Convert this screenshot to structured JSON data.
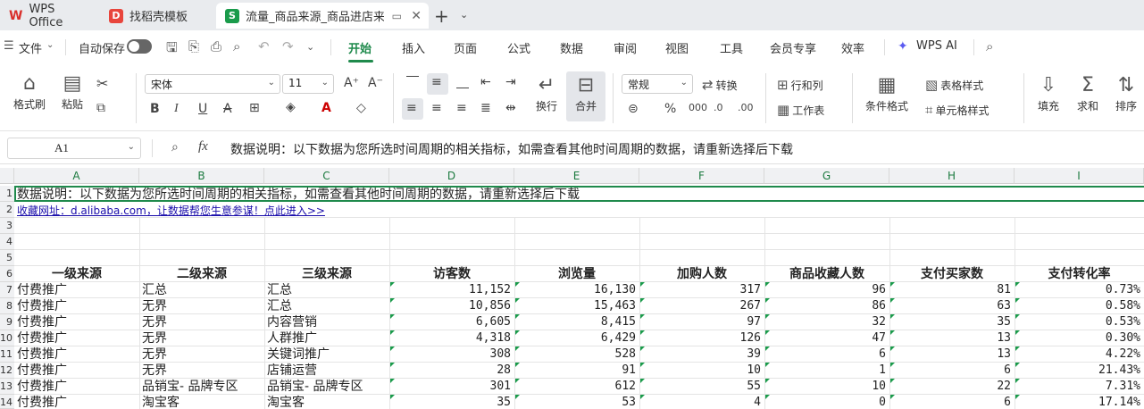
{
  "tabs": [
    {
      "label": "WPS Office",
      "icon": "wps-logo-icon",
      "active": false
    },
    {
      "label": "找稻壳模板",
      "icon": "docer-icon",
      "active": false
    },
    {
      "label": "流量_商品来源_商品进店来源",
      "icon": "spreadsheet-icon",
      "active": true
    }
  ],
  "menu": {
    "file": "文件",
    "autosave": "自动保存",
    "items": [
      "开始",
      "插入",
      "页面",
      "公式",
      "数据",
      "审阅",
      "视图",
      "工具",
      "会员专享",
      "效率"
    ],
    "wps_ai": "WPS AI",
    "active": "开始"
  },
  "ribbon": {
    "format_painter": "格式刷",
    "paste": "粘贴",
    "font_name": "宋体",
    "font_size": "11",
    "wrap": "换行",
    "merge": "合并",
    "number_format": "常规",
    "convert": "转换",
    "row_col": "行和列",
    "worksheet": "工作表",
    "cond_format": "条件格式",
    "table_style": "表格样式",
    "cell_style": "单元格样式",
    "fill": "填充",
    "sum": "求和",
    "sort": "排序",
    "accent": "#1f8a4c"
  },
  "formula_bar": {
    "cell_ref": "A1",
    "fx": "fx",
    "content": "数据说明：以下数据为您所选时间周期的相关指标，如需查看其他时间周期的数据，请重新选择后下载"
  },
  "columns": [
    "A",
    "B",
    "C",
    "D",
    "E",
    "F",
    "G",
    "H",
    "I"
  ],
  "rows": [
    "1",
    "2",
    "3",
    "4",
    "5",
    "6",
    "7",
    "8",
    "9",
    "10",
    "11",
    "12",
    "13",
    "14"
  ],
  "sheet": {
    "a1": "数据说明：以下数据为您所选时间周期的相关指标，如需查看其他时间周期的数据，请重新选择后下载",
    "a2": "收藏网址：d.alibaba.com，让数据帮您生意参谋！点此进入>>",
    "headers": [
      "一级来源",
      "二级来源",
      "三级来源",
      "访客数",
      "浏览量",
      "加购人数",
      "商品收藏人数",
      "支付买家数",
      "支付转化率"
    ],
    "data": [
      [
        "付费推广",
        "汇总",
        "汇总",
        "11,152",
        "16,130",
        "317",
        "96",
        "81",
        "0.73%"
      ],
      [
        "付费推广",
        "无界",
        "汇总",
        "10,856",
        "15,463",
        "267",
        "86",
        "63",
        "0.58%"
      ],
      [
        "付费推广",
        "无界",
        "内容营销",
        "6,605",
        "8,415",
        "97",
        "32",
        "35",
        "0.53%"
      ],
      [
        "付费推广",
        "无界",
        "人群推广",
        "4,318",
        "6,429",
        "126",
        "47",
        "13",
        "0.30%"
      ],
      [
        "付费推广",
        "无界",
        "关键词推广",
        "308",
        "528",
        "39",
        "6",
        "13",
        "4.22%"
      ],
      [
        "付费推广",
        "无界",
        "店铺运营",
        "28",
        "91",
        "10",
        "1",
        "6",
        "21.43%"
      ],
      [
        "付费推广",
        "品销宝- 品牌专区",
        "品销宝- 品牌专区",
        "301",
        "612",
        "55",
        "10",
        "22",
        "7.31%"
      ],
      [
        "付费推广",
        "淘宝客",
        "淘宝客",
        "35",
        "53",
        "4",
        "0",
        "6",
        "17.14%"
      ]
    ]
  }
}
